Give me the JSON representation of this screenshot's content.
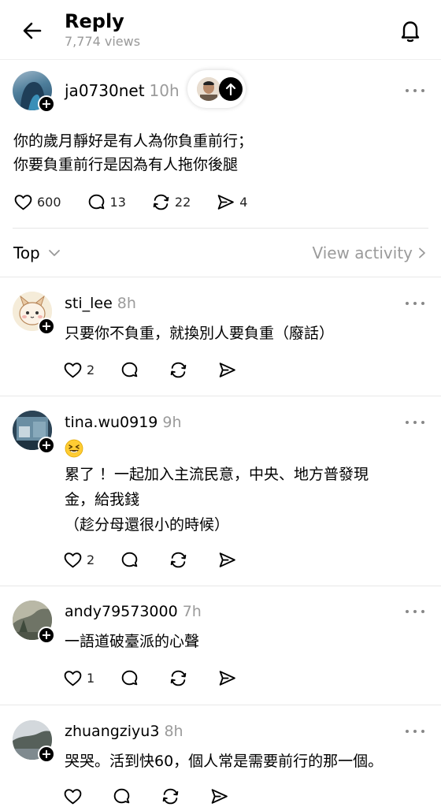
{
  "header": {
    "title": "Reply",
    "views": "7,774 views",
    "back_icon": "arrow-left-icon",
    "bell_icon": "bell-icon"
  },
  "post": {
    "username": "ja0730net",
    "time": "10h",
    "lines": [
      "你的歲月靜好是有人為你負重前行；",
      "你要負重前行是因為有人拖你後腿"
    ],
    "likes": "600",
    "comments": "13",
    "reposts": "22",
    "shares": "4"
  },
  "sort": {
    "label": "Top",
    "view_activity": "View activity"
  },
  "replies": [
    {
      "username": "sti_lee",
      "time": "8h",
      "lines": [
        "只要你不負重，就換別人要負重（廢話）"
      ],
      "likes": "2"
    },
    {
      "username": "tina.wu0919",
      "time": "9h",
      "emoji": "grinning-squinting-face",
      "lines": [
        "累了 ！一起加入主流民意，中央、地方普發現",
        "金，給我錢",
        "（趁分母還很小的時候）"
      ],
      "likes": "2"
    },
    {
      "username": "andy79573000",
      "time": "7h",
      "lines": [
        "一語道破臺派的心聲"
      ],
      "likes": "1"
    },
    {
      "username": "zhuangziyu3",
      "time": "8h",
      "lines": [
        "哭哭。活到快60，個人常是需要前行的那一個。"
      ],
      "likes": ""
    }
  ],
  "colors": {
    "muted": "#9b9b9b",
    "divider": "#e6e6e6",
    "text": "#000000"
  }
}
